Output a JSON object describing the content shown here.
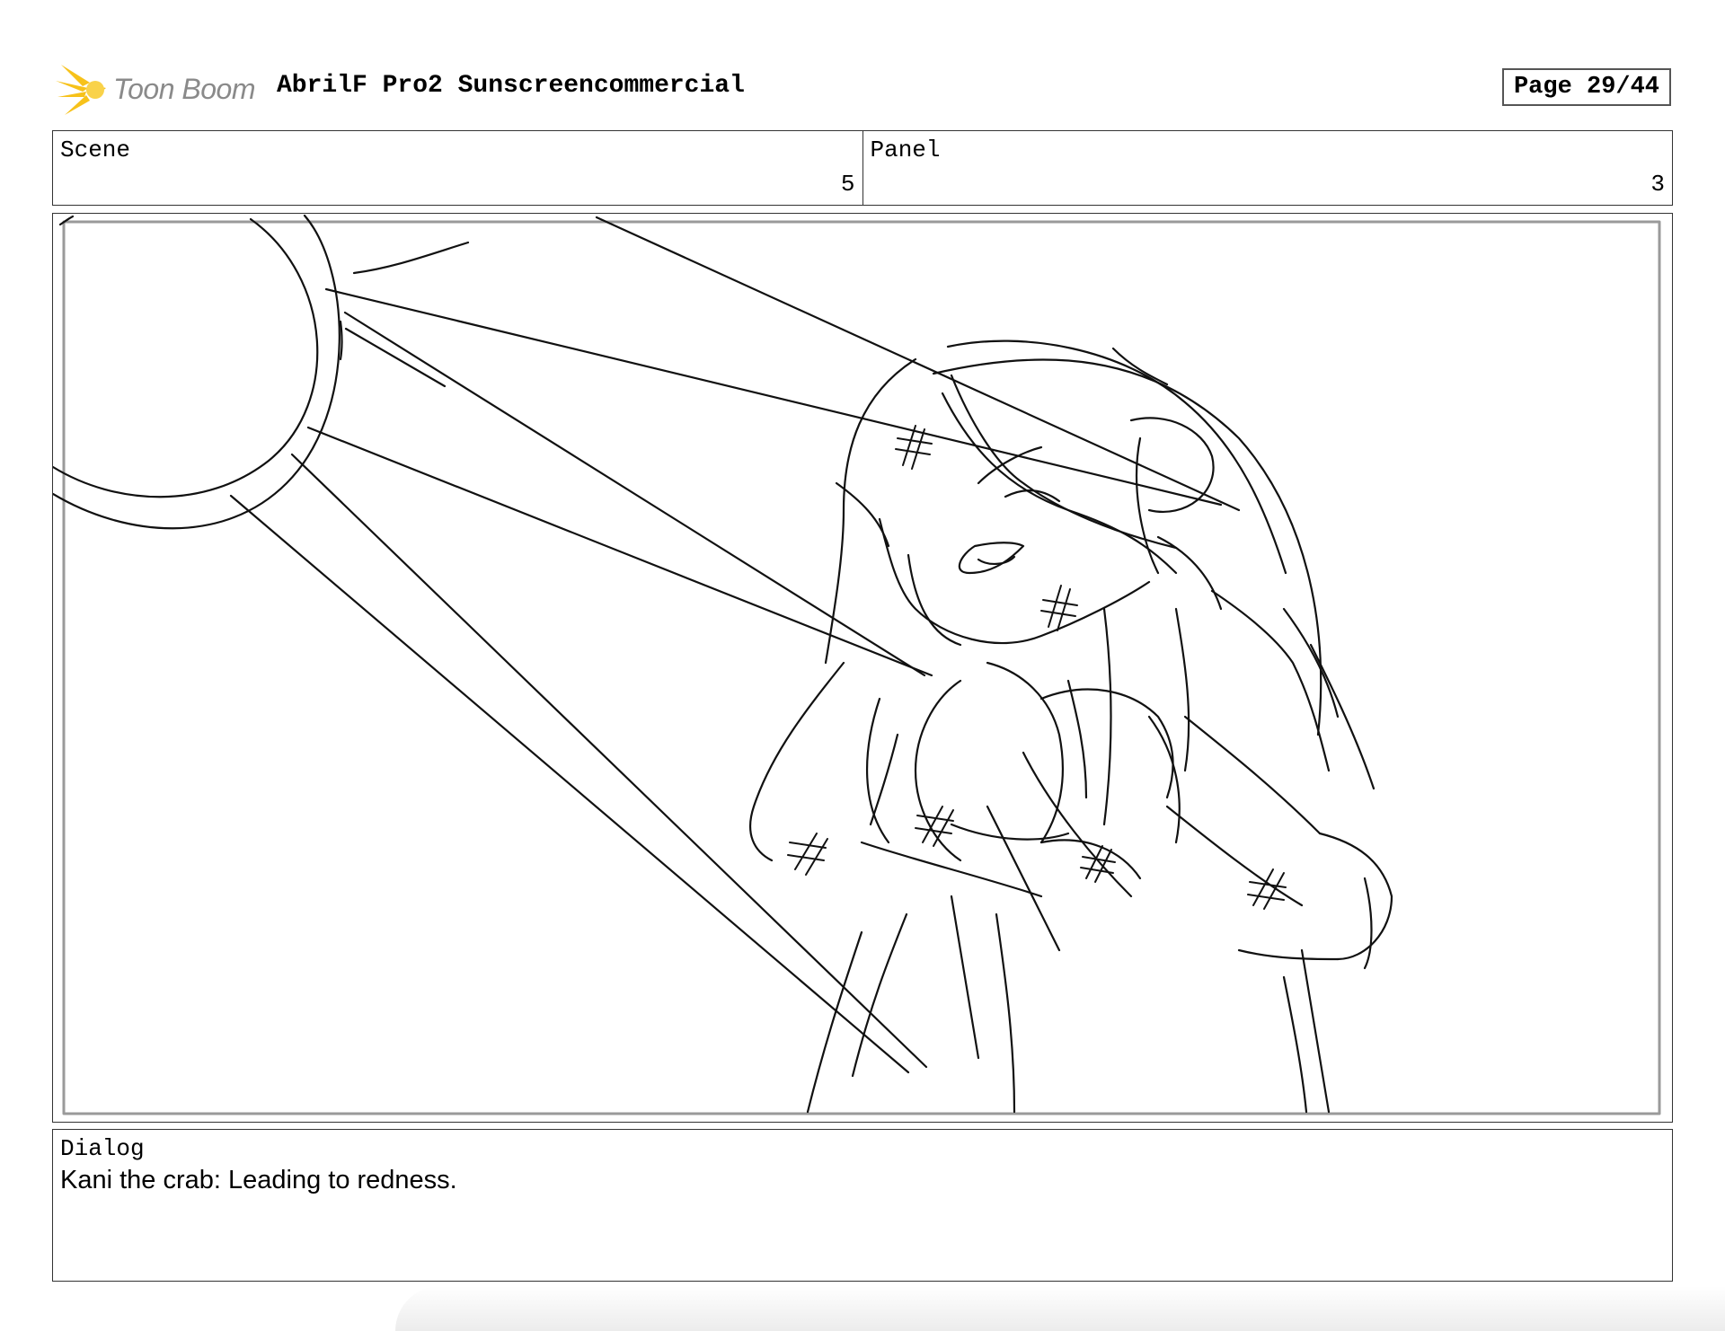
{
  "header": {
    "logo_text": "Toon Boom",
    "project_title": "AbrilF Pro2 Sunscreencommercial",
    "page_indicator": "Page 29/44"
  },
  "info": {
    "scene_label": "Scene",
    "scene_value": "5",
    "panel_label": "Panel",
    "panel_value": "3"
  },
  "dialog": {
    "label": "Dialog",
    "text": "Kani the crab: Leading to redness."
  },
  "colors": {
    "logo_yellow": "#f7c21a",
    "logo_text_gray": "#8a8a8a",
    "sketch_ink": "#111111"
  },
  "icons": {
    "logo": "starburst-logo-icon"
  }
}
